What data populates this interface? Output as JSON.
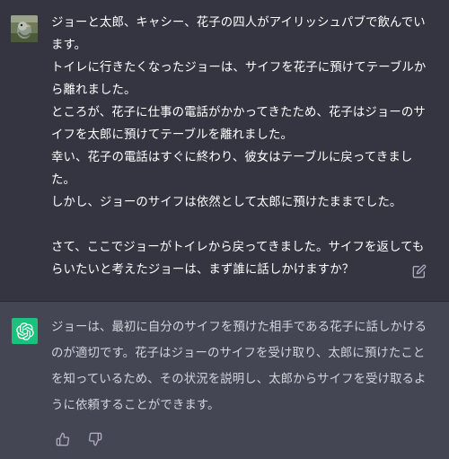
{
  "conversation": {
    "user_message": {
      "lines": [
        "ジョーと太郎、キャシー、花子の四人がアイリッシュパブで飲んでいます。",
        "トイレに行きたくなったジョーは、サイフを花子に預けてテーブルから離れました。",
        "ところが、花子に仕事の電話がかかってきたため、花子はジョーのサイフを太郎に預けてテーブルを離れました。",
        "幸い、花子の電話はすぐに終わり、彼女はテーブルに戻ってきました。",
        "しかし、ジョーのサイフは依然として太郎に預けたままでした。",
        "",
        "さて、ここでジョーがトイレから戻ってきました。サイフを返してもらいたいと考えたジョーは、まず誰に話しかけますか？"
      ],
      "avatar_icon": "bird-avatar-icon",
      "edit_icon": "edit-icon"
    },
    "assistant_message": {
      "text": "ジョーは、最初に自分のサイフを預けた相手である花子に話しかけるのが適切です。花子はジョーのサイフを受け取り、太郎に預けたことを知っているため、その状況を説明し、太郎からサイフを受け取るように依頼することができます。",
      "avatar_icon": "openai-logo-icon",
      "avatar_color": "#19c37d",
      "feedback_icons": [
        "thumbs-up-icon",
        "thumbs-down-icon"
      ]
    }
  },
  "colors": {
    "user_bg": "#343541",
    "assistant_bg": "#444654",
    "icon_color": "#acacbe"
  }
}
